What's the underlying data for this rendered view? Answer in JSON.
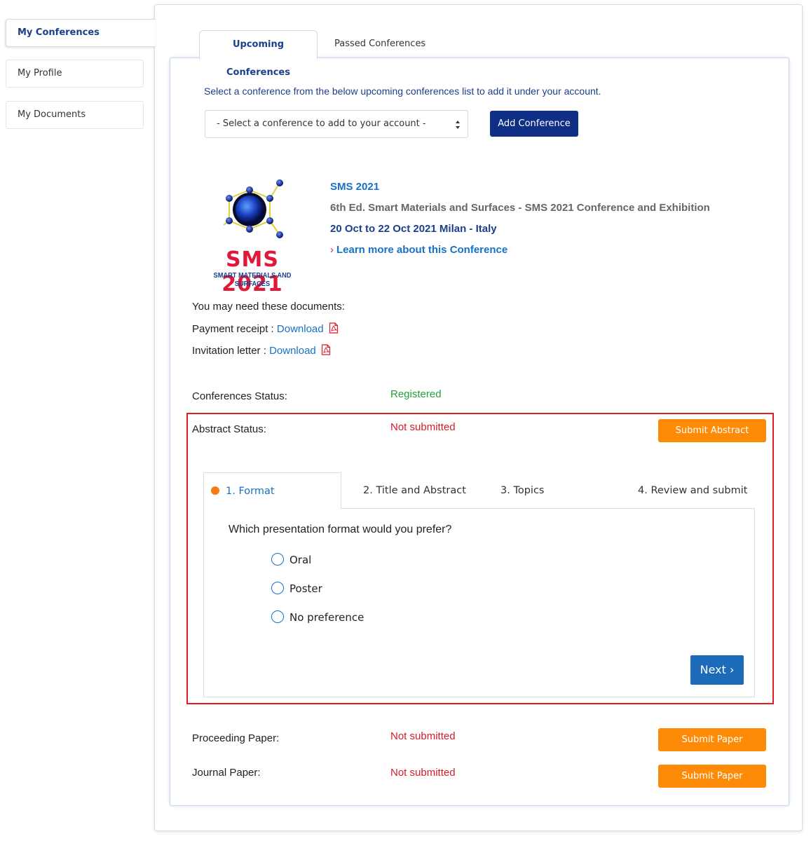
{
  "sidebar": {
    "items": [
      {
        "label": "My Conferences"
      },
      {
        "label": "My Profile"
      },
      {
        "label": "My Documents"
      }
    ]
  },
  "tabs": {
    "upcoming": "Upcoming Conferences",
    "passed": "Passed Conferences"
  },
  "select_section": {
    "instruction": "Select a conference from the below upcoming conferences list to add it under your account.",
    "dropdown_value": "- Select a conference to add to your account -",
    "add_button": "Add Conference"
  },
  "conference": {
    "logo_title": "SMS 2021",
    "logo_subtitle": "SMART MATERIALS AND SURFACES",
    "code": "SMS 2021",
    "name": "6th Ed. Smart Materials and Surfaces - SMS 2021 Conference and Exhibition",
    "dates": "20 Oct to 22 Oct 2021 Milan - Italy",
    "learn_more": "Learn more about this Conference"
  },
  "documents": {
    "title": "You may need these documents:",
    "payment_label": "Payment receipt : ",
    "invitation_label": "Invitation letter : ",
    "download_label": "Download"
  },
  "statuses": {
    "conference_label": "Conferences Status:",
    "conference_value": "Registered",
    "abstract_label": "Abstract Status:",
    "abstract_value": "Not submitted",
    "abstract_button": "Submit Abstract",
    "proceeding_label": "Proceeding Paper:",
    "proceeding_value": "Not submitted",
    "proceeding_button": "Submit Paper",
    "journal_label": "Journal Paper:",
    "journal_value": "Not submitted",
    "journal_button": "Submit Paper"
  },
  "wizard": {
    "steps": [
      {
        "label": "1. Format"
      },
      {
        "label": "2. Title and Abstract"
      },
      {
        "label": "3. Topics"
      },
      {
        "label": "4. Review and submit"
      }
    ],
    "question": "Which presentation format would you prefer?",
    "options": [
      {
        "label": "Oral"
      },
      {
        "label": "Poster"
      },
      {
        "label": "No preference"
      }
    ],
    "next_button": "Next ›"
  },
  "colors": {
    "brand_navy": "#0f2f86",
    "link_blue": "#1671c9",
    "status_green": "#23a03a",
    "status_red": "#d61b2a",
    "action_orange": "#fd8b08",
    "highlight_red": "#e01e25"
  },
  "icons": {
    "dropdown": "select-arrows-icon",
    "pdf": "pdf-file-icon",
    "learn_more": "chevron-right-icon",
    "active_step": "step-dot-icon"
  }
}
